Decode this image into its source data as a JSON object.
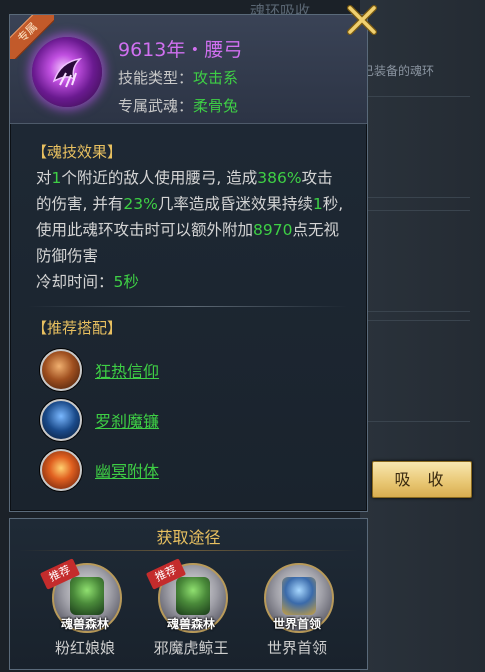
{
  "background": {
    "window_title": "魂环吸收",
    "side_text": "已装备的魂环"
  },
  "skill": {
    "badge": "专属",
    "title": "9613年・腰弓",
    "type_label": "技能类型：",
    "type_value": "攻击系",
    "weapon_label": "专属武魂：",
    "weapon_value": "柔骨兔"
  },
  "effect": {
    "heading": "【魂技效果】",
    "segments": [
      {
        "t": "对",
        "g": false
      },
      {
        "t": "1",
        "g": true
      },
      {
        "t": "个附近的敌人使用腰弓, 造成",
        "g": false
      },
      {
        "t": "386%",
        "g": true
      },
      {
        "t": "攻击的伤害, 并有",
        "g": false
      },
      {
        "t": "23%",
        "g": true
      },
      {
        "t": "几率造成昏迷效果持续",
        "g": false
      },
      {
        "t": "1",
        "g": true
      },
      {
        "t": "秒, 使用此魂环攻击时可以额外附加",
        "g": false
      },
      {
        "t": "8970",
        "g": true
      },
      {
        "t": "点无视防御伤害",
        "g": false
      }
    ],
    "cooldown_label": "冷却时间：",
    "cooldown_value": "5秒"
  },
  "recommend": {
    "heading": "【推荐搭配】",
    "items": [
      {
        "label": "狂热信仰",
        "icon": "fervent-faith-icon",
        "color": "#8a4a20"
      },
      {
        "label": "罗刹魔镰",
        "icon": "rakshasa-scythe-icon",
        "color": "#1a4a8a"
      },
      {
        "label": "幽冥附体",
        "icon": "nether-possession-icon",
        "color": "#a03010"
      }
    ]
  },
  "absorb_button": "吸 收",
  "source": {
    "heading": "获取途径",
    "items": [
      {
        "tag": "魂兽森林",
        "name": "粉红娘娘",
        "recommended": true,
        "rec_label": "推荐",
        "icon": "soul-forest-medal-icon"
      },
      {
        "tag": "魂兽森林",
        "name": "邪魔虎鲸王",
        "recommended": true,
        "rec_label": "推荐",
        "icon": "soul-forest-medal-icon"
      },
      {
        "tag": "世界首领",
        "name": "世界首领",
        "recommended": false,
        "rec_label": "",
        "icon": "world-boss-medal-icon"
      }
    ]
  },
  "colors": {
    "green": "#3ecf45",
    "gold": "#e8c060",
    "purple": "#d070f0"
  }
}
